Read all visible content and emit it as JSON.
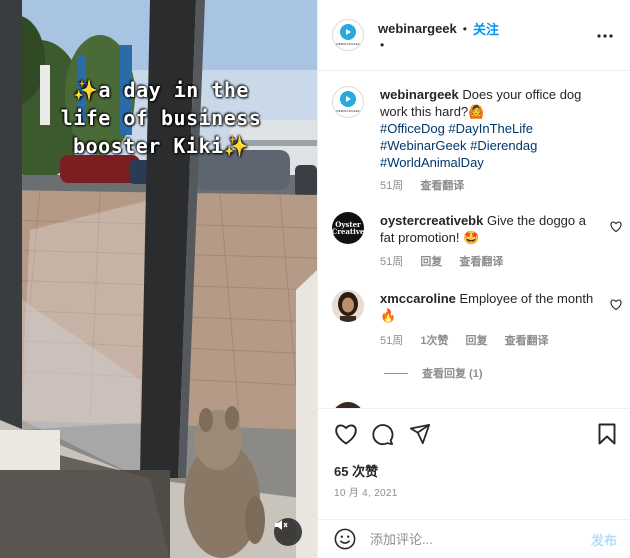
{
  "header": {
    "username": "webinargeek",
    "separator": "•",
    "follow_label": "关注",
    "sub_dot": "•",
    "avatar_brand": "WEBINARGEEK"
  },
  "media": {
    "overlay_line1": "a day in the",
    "overlay_line2": "life of business",
    "overlay_line3": "booster Kiki",
    "sparkle": "✨"
  },
  "caption": {
    "username": "webinargeek",
    "text": "Does your office dog work this hard?",
    "emoji": "🙆",
    "hashtags": [
      "#OfficeDog",
      "#DayInTheLife",
      "#WebinarGeek",
      "#Dierendag",
      "#WorldAnimalDay"
    ],
    "time": "51周",
    "translate": "查看翻译"
  },
  "comments": [
    {
      "username": "oystercreativebk",
      "text": "Give the doggo a fat promotion!",
      "emoji": "🤩",
      "avatar_text": "Oyster Creative",
      "time": "51周",
      "reply": "回复",
      "translate": "查看翻译"
    },
    {
      "username": "xmccaroline",
      "text": "Employee of the month",
      "emoji": "🔥",
      "time": "51周",
      "likes": "1次赞",
      "reply": "回复",
      "translate": "查看翻译",
      "view_replies": "查看回复 (1)"
    }
  ],
  "actions": {
    "likes": "65 次赞",
    "date": "10 月 4, 2021"
  },
  "add_comment": {
    "placeholder": "添加评论...",
    "post_label": "发布"
  },
  "colors": {
    "accent": "#0095f6",
    "hashtag": "#00376b",
    "muted": "#8e8e8e",
    "post_disabled": "#b2dffc",
    "brand_blue": "#29a9e0"
  },
  "icons": [
    "more-options-icon",
    "heart-icon",
    "comment-icon",
    "share-icon",
    "bookmark-icon",
    "smiley-icon",
    "mute-icon"
  ]
}
